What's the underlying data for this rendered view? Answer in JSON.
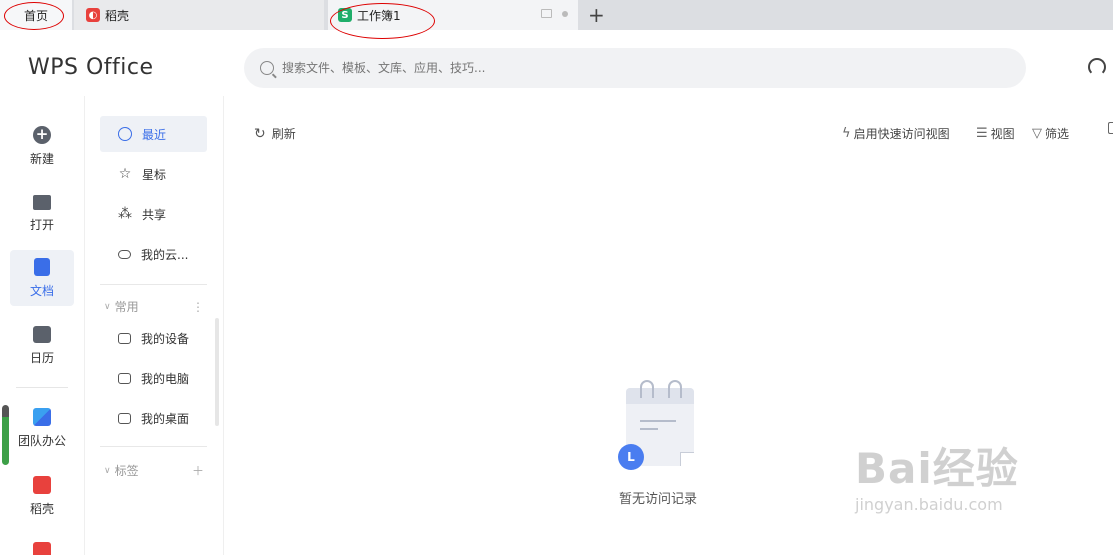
{
  "tabs": [
    {
      "label": "首页"
    },
    {
      "label": "稻壳"
    },
    {
      "label": "工作簿1"
    }
  ],
  "tab_icons": {
    "daoke": "daoke-logo-icon",
    "workbook": "spreadsheet-icon",
    "add": "plus-icon"
  },
  "header": {
    "logo": "WPS Office",
    "search_placeholder": "搜索文件、模板、文库、应用、技巧..."
  },
  "left_nav": {
    "new": "新建",
    "open": "打开",
    "docs": "文档",
    "calendar": "日历",
    "team": "团队办公",
    "daoke": "稻壳"
  },
  "sub_nav": {
    "recent": "最近",
    "starred": "星标",
    "shared": "共享",
    "cloud": "我的云...",
    "common_section": "常用",
    "my_devices": "我的设备",
    "my_pc": "我的电脑",
    "my_desktop": "我的桌面",
    "tags_section": "标签"
  },
  "toolbar": {
    "refresh": "刷新",
    "quick_view": "启用快速访问视图",
    "view": "视图",
    "filter": "筛选"
  },
  "empty_state": {
    "text": "暂无访问记录"
  },
  "watermark": {
    "big": "Bai经验",
    "small": "jingyan.baidu.com"
  },
  "colors": {
    "accent": "#3a6ee8",
    "active_bg": "#eef1f6",
    "daoke_red": "#e8413d",
    "et_green": "#1fae6a",
    "annotation": "#dd0000"
  }
}
